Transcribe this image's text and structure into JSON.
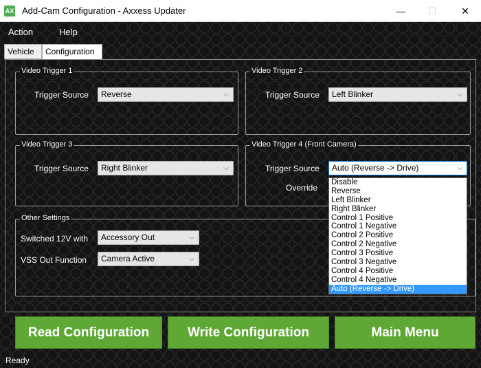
{
  "window": {
    "app_icon_text": "AX",
    "title": "Add-Cam Configuration - Axxess Updater",
    "minimize_glyph": "—",
    "maximize_glyph": "☐",
    "close_glyph": "✕"
  },
  "menu": {
    "items": [
      "Action",
      "Help"
    ]
  },
  "tabs": [
    {
      "label": "Vehicle",
      "active": false
    },
    {
      "label": "Configuration",
      "active": true
    }
  ],
  "groups": {
    "vt1": {
      "title": "Video Trigger 1",
      "trigger_label": "Trigger Source",
      "trigger_value": "Reverse"
    },
    "vt2": {
      "title": "Video Trigger 2",
      "trigger_label": "Trigger Source",
      "trigger_value": "Left Blinker"
    },
    "vt3": {
      "title": "Video Trigger 3",
      "trigger_label": "Trigger Source",
      "trigger_value": "Right Blinker"
    },
    "vt4": {
      "title": "Video Trigger 4 (Front Camera)",
      "trigger_label": "Trigger Source",
      "trigger_value": "Auto (Reverse -> Drive)",
      "override_label": "Override"
    },
    "other": {
      "title": "Other Settings",
      "switched_label": "Switched 12V with",
      "switched_value": "Accessory Out",
      "vss_label": "VSS Out Function",
      "vss_value": "Camera Active"
    }
  },
  "dropdown": {
    "options": [
      "Disable",
      "Reverse",
      "Left Blinker",
      "Right Blinker",
      "Control 1 Positive",
      "Control 1 Negative",
      "Control 2 Positive",
      "Control 2 Negative",
      "Control 3 Positive",
      "Control 3 Negative",
      "Control 4 Positive",
      "Control 4 Negative",
      "Auto (Reverse -> Drive)"
    ],
    "selected_index": 12
  },
  "buttons": {
    "read": "Read Configuration",
    "write": "Write Configuration",
    "main_menu": "Main Menu"
  },
  "status": {
    "text": "Ready"
  },
  "icons": {
    "chevron": "chevron-down-icon",
    "chevron_glyph": "⌵"
  },
  "colors": {
    "button_green": "#5fa836",
    "selection_blue": "#3399ff",
    "focus_border": "#0078d7"
  }
}
